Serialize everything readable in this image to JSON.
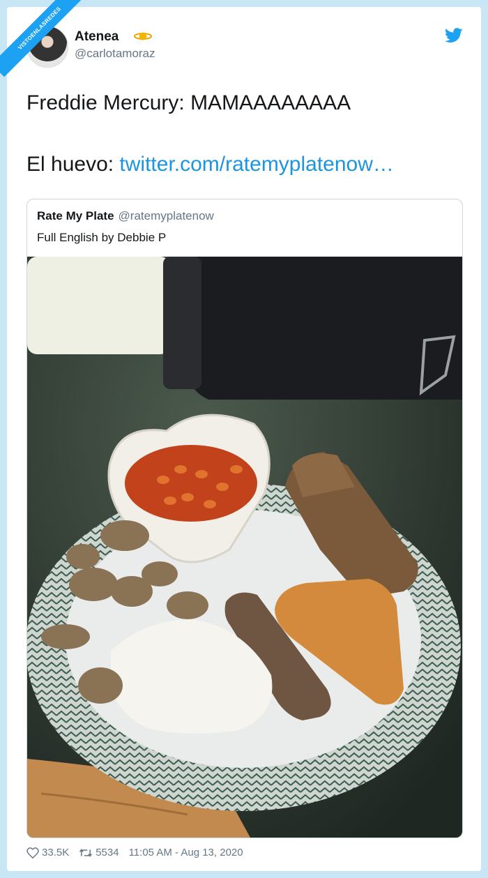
{
  "watermark": "VISTOENLASREDES",
  "author": {
    "name": "Atenea",
    "handle": "@carlotamoraz"
  },
  "tweet": {
    "line1": "Freddie Mercury: MAMAAAAAAAA",
    "line2_prefix": "El huevo: ",
    "line2_link": "twitter.com/ratemyplatenow…"
  },
  "quoted": {
    "name": "Rate My Plate",
    "handle": "@ratemyplatenow",
    "text": "Full English by Debbie P"
  },
  "footer": {
    "likes": "33.5K",
    "retweets": "5534",
    "timestamp": "11:05 AM - Aug 13, 2020"
  },
  "colors": {
    "accent": "#1da1f2",
    "link": "#1b95e0",
    "muted": "#657786"
  }
}
